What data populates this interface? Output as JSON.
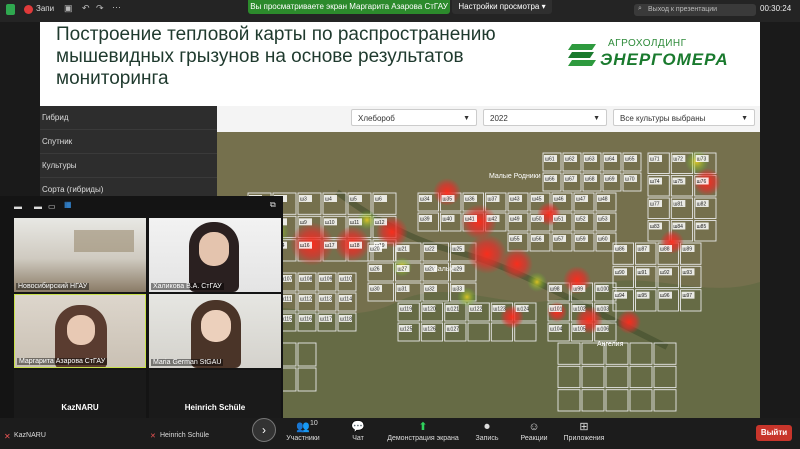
{
  "top_bar": {
    "left_label": "Запи",
    "share_banner": "Вы просматриваете экран Маргарита Азарова СтГАУ",
    "view_options": "Настройки просмотра",
    "search_presentation": "Выход к презентации",
    "clock": "00:30:24"
  },
  "slide": {
    "title": "Построение тепловой карты по распространению мышевидных грызунов на основе результатов мониторинга",
    "logo_top": "АГРОХОЛДИНГ",
    "logo_main": "ЭНЕРГОМЕРА"
  },
  "app": {
    "sidebar_items": [
      "Гибрид",
      "Спутник",
      "Культуры",
      "Сорта (гибриды)"
    ],
    "dropdowns": {
      "farm": "Хлебороб",
      "year": "2022",
      "crops": "Все культуры выбраны"
    },
    "map_labels": {
      "village_top": "Малые Родники",
      "village_mid": "Малые",
      "village_bottom": "Ангелия"
    },
    "field_labels": [
      "ш1",
      "ш2",
      "ш3",
      "ш4",
      "ш5",
      "ш6",
      "ш7",
      "ш8",
      "ш9",
      "ш10",
      "ш11",
      "ш12",
      "ш13",
      "ш14",
      "ш16",
      "ш17",
      "ш18",
      "ш19",
      "ш20",
      "ш21",
      "ш22",
      "ш25",
      "ш26",
      "ш27",
      "ш28",
      "ш29",
      "ш30",
      "ш31",
      "ш32",
      "ш33",
      "ш34",
      "ш35",
      "ш36",
      "ш37",
      "ш39",
      "ш40",
      "ш41",
      "ш42",
      "ш43",
      "ш45",
      "ш46",
      "ш47",
      "ш48",
      "ш49",
      "ш50",
      "ш51",
      "ш52",
      "ш53",
      "ш55",
      "ш56",
      "ш57",
      "ш59",
      "ш60",
      "ш61",
      "ш62",
      "ш63",
      "ш64",
      "ш65",
      "ш66",
      "ш67",
      "ш68",
      "ш69",
      "ш70",
      "ш71",
      "ш72",
      "ш73",
      "ш74",
      "ш75",
      "ш76",
      "ш77",
      "ш81",
      "ш82",
      "ш83",
      "ш84",
      "ш85",
      "ш86",
      "ш87",
      "ш88",
      "ш89",
      "ш90",
      "ш91",
      "ш92",
      "ш93",
      "ш94",
      "ш95",
      "ш96",
      "ш97",
      "ш98",
      "ш99",
      "ш100",
      "ш101",
      "ш102",
      "ш103",
      "ш104",
      "ш105",
      "ш106",
      "ш107",
      "ш108",
      "ш109",
      "ш110",
      "ш111",
      "ш112",
      "ш113",
      "ш114",
      "ш115",
      "ш116",
      "ш117",
      "ш118",
      "ш119",
      "ш120",
      "ш121",
      "ш122",
      "ш123",
      "ш124",
      "ш125",
      "ш126",
      "ш127"
    ]
  },
  "gallery": {
    "participants": [
      "Новосибирский НГАУ",
      "Халикова В.А. СтГАУ",
      "Маргарита Азарова СтГАУ",
      "Maria German StGAU",
      "KazNARU",
      "Heinrich Schüle"
    ],
    "self_view": [
      "KazNARU",
      "Heinrich Schüle"
    ]
  },
  "bottom_bar": {
    "participants_label": "Участники",
    "participants_count": "10",
    "chat": "Чат",
    "share_screen": "Демонстрация экрана",
    "record": "Запись",
    "reactions": "Реакции",
    "apps": "Приложения",
    "leave": "Выйти"
  },
  "colors": {
    "share_green": "#2c8a2c",
    "leave_red": "#c8352b",
    "heat_red": "#e0302a",
    "logo_green": "#1a7a2e"
  }
}
